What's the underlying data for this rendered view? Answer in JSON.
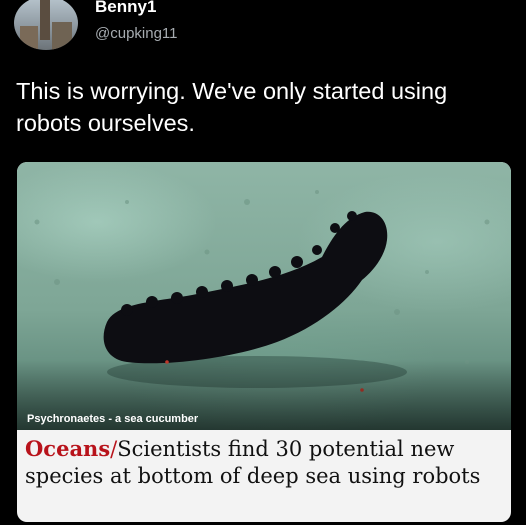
{
  "author": {
    "name": "Benny1",
    "handle": "@cupking11",
    "avatar_icon": "avatar-city-tower"
  },
  "tweet": {
    "text": "This is worrying. We've only started using robots ourselves."
  },
  "card": {
    "image_caption": "Psychronaetes - a sea cucumber",
    "section": "Oceans",
    "separator": "/",
    "headline": "Scientists find 30 potential new species at bottom of deep sea using robots"
  },
  "colors": {
    "background": "#000000",
    "section_red": "#b8131b",
    "handle_gray": "#a6abb0"
  }
}
